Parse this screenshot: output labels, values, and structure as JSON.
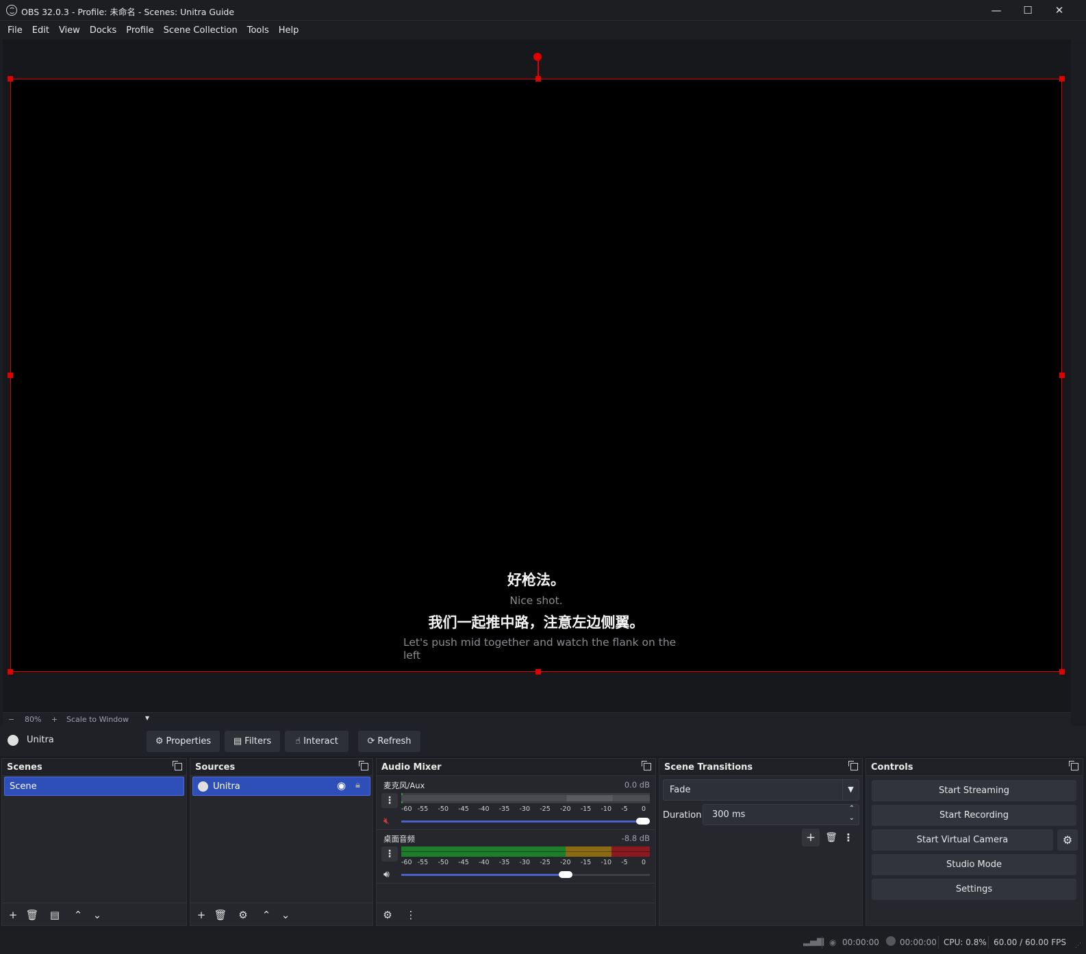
{
  "window": {
    "title": "OBS 32.0.3 - Profile: 未命名 - Scenes: Unitra Guide",
    "minimize": "—",
    "maximize": "☐",
    "close": "✕"
  },
  "menu": [
    "File",
    "Edit",
    "View",
    "Docks",
    "Profile",
    "Scene Collection",
    "Tools",
    "Help"
  ],
  "preview": {
    "subtitles": [
      "好枪法。",
      "Nice shot.",
      "我们一起推中路，注意左边侧翼。",
      "Let's push mid together and watch the flank on the left"
    ],
    "zoom_minus": "−",
    "zoom_level": "80%",
    "zoom_plus": "+",
    "scale_mode": "Scale to Window"
  },
  "source_toolbar": {
    "source_name": "Unitra",
    "properties": "Properties",
    "filters": "Filters",
    "interact": "Interact",
    "refresh": "Refresh"
  },
  "scenes": {
    "title": "Scenes",
    "items": [
      "Scene"
    ]
  },
  "sources": {
    "title": "Sources",
    "items": [
      "Unitra"
    ]
  },
  "audio_mixer": {
    "title": "Audio Mixer",
    "channels": [
      {
        "name": "麦克风/Aux",
        "db": "0.0 dB",
        "muted": true,
        "volume_fraction": 1.0
      },
      {
        "name": "桌面音频",
        "db": "-8.8 dB",
        "muted": false,
        "volume_fraction": 0.67
      }
    ],
    "ticks": [
      "-60",
      "-55",
      "-50",
      "-45",
      "-40",
      "-35",
      "-30",
      "-25",
      "-20",
      "-15",
      "-10",
      "-5",
      "0"
    ]
  },
  "scene_transitions": {
    "title": "Scene Transitions",
    "transition": "Fade",
    "duration_label": "Duration",
    "duration_value": "300 ms"
  },
  "controls": {
    "title": "Controls",
    "start_streaming": "Start Streaming",
    "start_recording": "Start Recording",
    "start_virtual_camera": "Start Virtual Camera",
    "studio_mode": "Studio Mode",
    "settings": "Settings"
  },
  "status": {
    "stream_time": "00:00:00",
    "record_time": "00:00:00",
    "cpu": "CPU: 0.8%",
    "fps": "60.00 / 60.00 FPS"
  },
  "colors": {
    "accent_selection": "#2f4fb8",
    "bounding_box": "#e00000",
    "meter_green": "#1e7d2a",
    "meter_yellow": "#8a6a12",
    "meter_red": "#8a1a22"
  }
}
